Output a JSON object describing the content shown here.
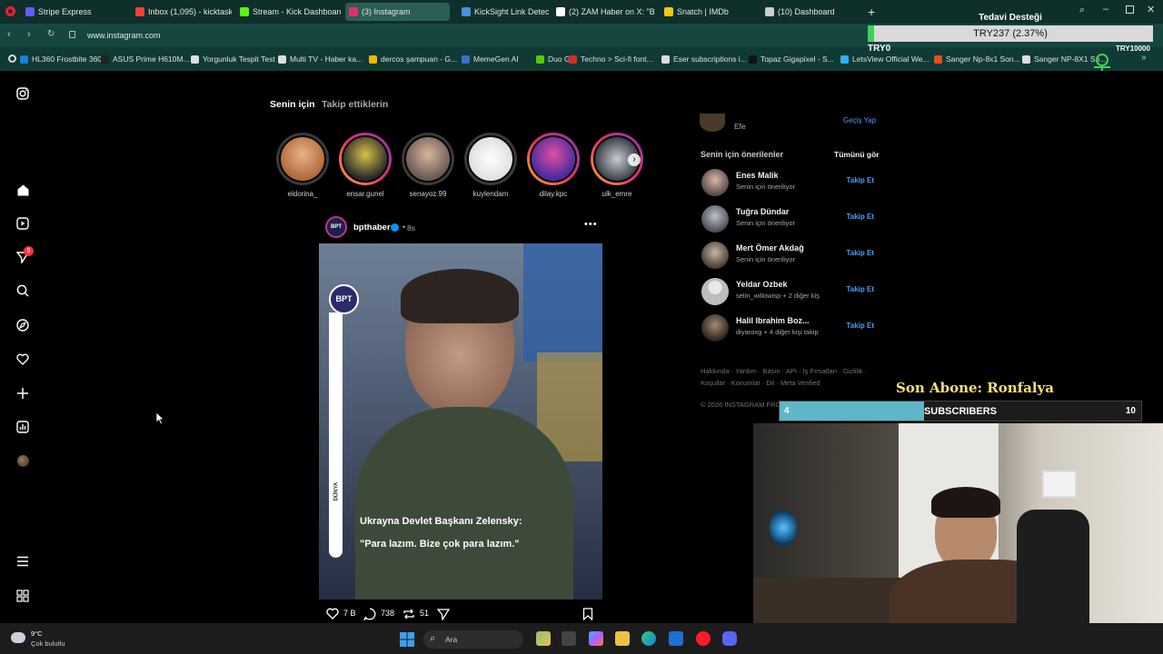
{
  "browser": {
    "tabs": [
      {
        "label": "Stripe Express",
        "color": "#635bff"
      },
      {
        "label": "Inbox (1,095) - kicktaskin",
        "color": "#ea4335"
      },
      {
        "label": "Stream - Kick Dashboard",
        "color": "#53fc18"
      },
      {
        "label": "(3) Instagram",
        "color": "#e1306c"
      },
      {
        "label": "KickSight Link Detector",
        "color": "#4a90e2"
      },
      {
        "label": "(2) ZAM Haber on X: \"Bir",
        "color": "#ffffff"
      },
      {
        "label": "Snatch | IMDb",
        "color": "#f5c518"
      },
      {
        "label": "(10) Dashboard",
        "color": "#cccccc"
      }
    ],
    "url": "www.instagram.com",
    "bookmarks": [
      "HL360 Frostbite 360...",
      "ASUS Prime H610M...",
      "Yorgunluk Tespit Test",
      "Multi TV - Haber ka...",
      "dercos şampuan - G...",
      "MemeGen AI",
      "Duo Go",
      "Techno > Sci-fi font...",
      "Eser subscriptions i...",
      "Topaz Gigapixel - S...",
      "LetsView Official We...",
      "Sanger Np-8x1 Son...",
      "Sanger NP-8X1 So..."
    ]
  },
  "donation": {
    "title": "Tedavi Desteği",
    "amount": "TRY237 (2.37%)",
    "min": "TRY0",
    "max": "TRY10000",
    "progress": 0.0237
  },
  "instagram": {
    "feed_tabs": [
      "Senin için",
      "Takip ettiklerin"
    ],
    "notification_count": "5",
    "stories": [
      {
        "name": "eldorina_",
        "seen": true
      },
      {
        "name": "ensar.gunel",
        "seen": false
      },
      {
        "name": "senayoz.99",
        "seen": true
      },
      {
        "name": "kuylendam",
        "seen": true
      },
      {
        "name": "dilay.kpc",
        "seen": false
      },
      {
        "name": "ulk_emre",
        "seen": false
      }
    ],
    "post": {
      "username": "bpthaber",
      "time": "8s",
      "badge": "BPT",
      "side_label": "DÜNYA",
      "headline": "Ukrayna Devlet Başkanı Zelensky:",
      "quote": "\"Para lazım. Bize çok para lazım.\"",
      "likes": "7 B",
      "comments": "738",
      "reposts": "51"
    },
    "account": {
      "name": "Efe",
      "switch": "Geçiş Yap"
    },
    "suggestions_title": "Senin için önerilenler",
    "see_all": "Tümünü gör",
    "follow_label": "Takip Et",
    "suggestions": [
      {
        "name": "Enes Malik",
        "sub": "Senin için öneriliyor"
      },
      {
        "name": "Tuğra Dündar",
        "sub": "Senin için öneriliyor"
      },
      {
        "name": "Mert Ömer Akdağ",
        "sub": "Senin için öneriliyor"
      },
      {
        "name": "Yeldar Ozbek",
        "sub": "selin_willowisp + 2 diğer kiş"
      },
      {
        "name": "Halil Ibrahim Boz...",
        "sub": "diyaroxg + 4 diğer kişi takip"
      }
    ],
    "footer_links_1": "Hakkında · Yardım · Basın · API · İş Fırsatları · Gizlilik ·",
    "footer_links_2": "Koşullar · Konumlar · Dil · Meta Verified",
    "copyright": "© 2026 INSTAGRAM FRO"
  },
  "stream_overlay": {
    "last_sub": "Son Abone: Ronfalya",
    "sub_current": "4",
    "sub_label": "SUBSCRIBERS",
    "sub_goal": "10",
    "sub_progress": 0.4
  },
  "taskbar": {
    "weather_temp": "9°C",
    "weather_desc": "Çok bulutlu",
    "search": "Ara"
  }
}
